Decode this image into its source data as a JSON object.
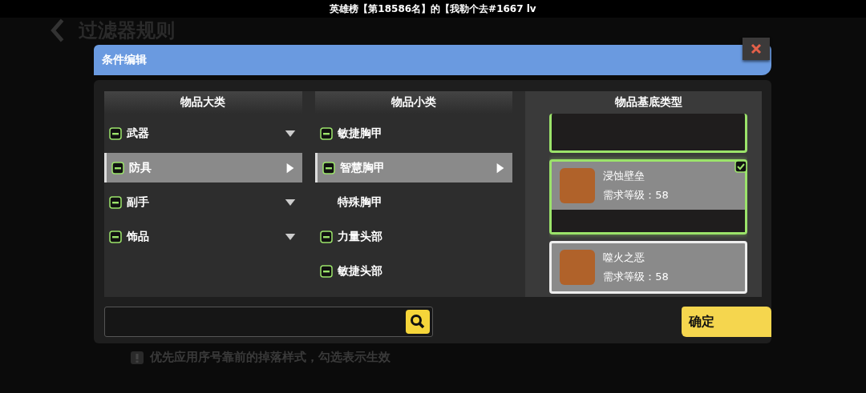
{
  "top_banner": {
    "text": "英雄榜【第18586名】的【我勒个去#1667 lv"
  },
  "background_page": {
    "title": "过滤器规则",
    "hint": "优先应用序号靠前的掉落样式，勾选表示生效"
  },
  "dialog": {
    "title": "条件编辑",
    "categories": {
      "heading": "物品大类",
      "items": [
        {
          "label": "武器",
          "indeterminate": true,
          "selected": false
        },
        {
          "label": "防具",
          "indeterminate": true,
          "selected": true
        },
        {
          "label": "副手",
          "indeterminate": true,
          "selected": false
        },
        {
          "label": "饰品",
          "indeterminate": true,
          "selected": false
        }
      ]
    },
    "subcategories": {
      "heading": "物品小类",
      "items": [
        {
          "label": "敏捷胸甲",
          "indeterminate": true,
          "selected": false
        },
        {
          "label": "智慧胸甲",
          "indeterminate": true,
          "selected": true
        },
        {
          "label": "特殊胸甲",
          "indeterminate": false,
          "selected": false
        },
        {
          "label": "力量头部",
          "indeterminate": true,
          "selected": false
        },
        {
          "label": "敏捷头部",
          "indeterminate": true,
          "selected": false
        }
      ]
    },
    "base_types": {
      "heading": "物品基底类型",
      "items": [
        {
          "name": "浸蚀壁垒",
          "requirement": "需求等级：58",
          "checked": true
        },
        {
          "name": "噬火之恶",
          "requirement": "需求等级：58",
          "checked": false
        }
      ]
    },
    "confirm_button": "确定"
  }
}
